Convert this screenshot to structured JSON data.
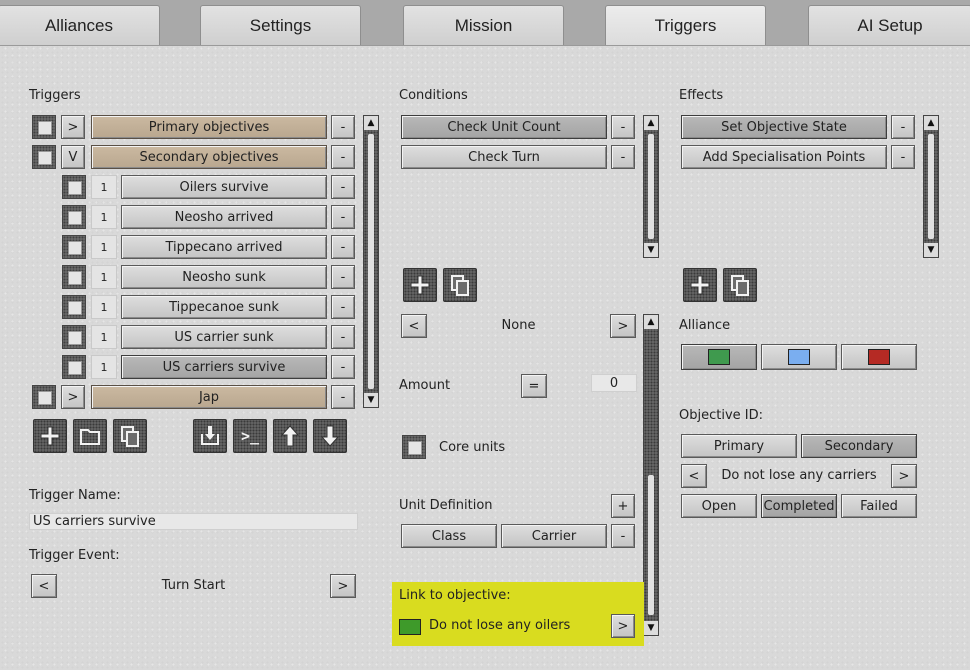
{
  "tabs": [
    "Alliances",
    "Settings",
    "Mission",
    "Triggers",
    "AI Setup"
  ],
  "triggers": {
    "heading": "Triggers",
    "groups": [
      {
        "expander": ">",
        "label": "Primary objectives",
        "remove": "-"
      },
      {
        "expander": "V",
        "label": "Secondary objectives",
        "remove": "-"
      },
      {
        "expander": ">",
        "label": "Jap",
        "remove": "-"
      }
    ],
    "children": [
      {
        "count": "1",
        "label": "Oilers survive",
        "remove": "-"
      },
      {
        "count": "1",
        "label": "Neosho arrived",
        "remove": "-"
      },
      {
        "count": "1",
        "label": "Tippecano arrived",
        "remove": "-"
      },
      {
        "count": "1",
        "label": "Neosho sunk",
        "remove": "-"
      },
      {
        "count": "1",
        "label": "Tippecanoe sunk",
        "remove": "-"
      },
      {
        "count": "1",
        "label": "US carrier sunk",
        "remove": "-"
      },
      {
        "count": "1",
        "label": "US carriers survive",
        "remove": "-"
      }
    ],
    "toolbar_icons": [
      "add-icon",
      "folder-icon",
      "copy-icon",
      "import-icon",
      "console-icon",
      "arrow-up-icon",
      "arrow-down-icon"
    ],
    "console_glyph": ">_"
  },
  "trigger_name": {
    "label": "Trigger Name:",
    "value": "US carriers survive"
  },
  "trigger_event": {
    "label": "Trigger Event:",
    "prev": "<",
    "value": "Turn Start",
    "next": ">"
  },
  "conditions": {
    "heading": "Conditions",
    "items": [
      {
        "label": "Check Unit Count",
        "remove": "-"
      },
      {
        "label": "Check Turn",
        "remove": "-"
      }
    ],
    "selector": {
      "prev": "<",
      "value": "None",
      "next": ">"
    },
    "amount": {
      "label": "Amount",
      "operator": "=",
      "value": "0"
    },
    "core_units": "Core units",
    "unit_definition": {
      "label": "Unit Definition",
      "add": "+",
      "class_label": "Class",
      "type_label": "Carrier",
      "remove": "-"
    },
    "link": {
      "label": "Link to objective:",
      "value": "Do not lose any oilers",
      "next": ">",
      "swatch_color": "#3e9a2a",
      "highlight_color": "#d9dc1f"
    }
  },
  "effects": {
    "heading": "Effects",
    "items": [
      {
        "label": "Set Objective State",
        "remove": "-"
      },
      {
        "label": "Add Specialisation Points",
        "remove": "-"
      }
    ]
  },
  "alliance": {
    "label": "Alliance",
    "colors": [
      "#3f9a4e",
      "#7aaef0",
      "#b52a24"
    ],
    "selected": 0
  },
  "objective": {
    "label": "Objective ID:",
    "types": [
      "Primary",
      "Secondary"
    ],
    "selected_type": "Secondary",
    "selector": {
      "prev": "<",
      "value": "Do not lose any carriers",
      "next": ">"
    },
    "states": [
      "Open",
      "Completed",
      "Failed"
    ],
    "selected_state": "Completed"
  },
  "scroll_arrows": {
    "up": "▲",
    "down": "▼"
  }
}
